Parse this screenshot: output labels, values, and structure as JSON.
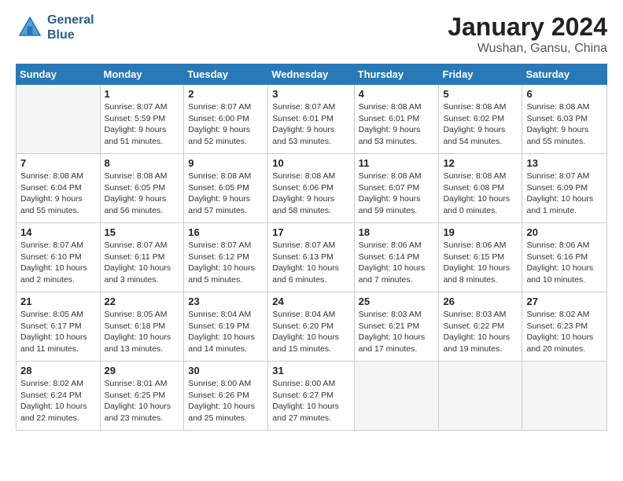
{
  "header": {
    "logo_line1": "General",
    "logo_line2": "Blue",
    "main_title": "January 2024",
    "subtitle": "Wushan, Gansu, China"
  },
  "calendar": {
    "days_of_week": [
      "Sunday",
      "Monday",
      "Tuesday",
      "Wednesday",
      "Thursday",
      "Friday",
      "Saturday"
    ],
    "weeks": [
      [
        {
          "day": "",
          "info": ""
        },
        {
          "day": "1",
          "info": "Sunrise: 8:07 AM\nSunset: 5:59 PM\nDaylight: 9 hours\nand 51 minutes."
        },
        {
          "day": "2",
          "info": "Sunrise: 8:07 AM\nSunset: 6:00 PM\nDaylight: 9 hours\nand 52 minutes."
        },
        {
          "day": "3",
          "info": "Sunrise: 8:07 AM\nSunset: 6:01 PM\nDaylight: 9 hours\nand 53 minutes."
        },
        {
          "day": "4",
          "info": "Sunrise: 8:08 AM\nSunset: 6:01 PM\nDaylight: 9 hours\nand 53 minutes."
        },
        {
          "day": "5",
          "info": "Sunrise: 8:08 AM\nSunset: 6:02 PM\nDaylight: 9 hours\nand 54 minutes."
        },
        {
          "day": "6",
          "info": "Sunrise: 8:08 AM\nSunset: 6:03 PM\nDaylight: 9 hours\nand 55 minutes."
        }
      ],
      [
        {
          "day": "7",
          "info": "Sunrise: 8:08 AM\nSunset: 6:04 PM\nDaylight: 9 hours\nand 55 minutes."
        },
        {
          "day": "8",
          "info": "Sunrise: 8:08 AM\nSunset: 6:05 PM\nDaylight: 9 hours\nand 56 minutes."
        },
        {
          "day": "9",
          "info": "Sunrise: 8:08 AM\nSunset: 6:05 PM\nDaylight: 9 hours\nand 57 minutes."
        },
        {
          "day": "10",
          "info": "Sunrise: 8:08 AM\nSunset: 6:06 PM\nDaylight: 9 hours\nand 58 minutes."
        },
        {
          "day": "11",
          "info": "Sunrise: 8:08 AM\nSunset: 6:07 PM\nDaylight: 9 hours\nand 59 minutes."
        },
        {
          "day": "12",
          "info": "Sunrise: 8:08 AM\nSunset: 6:08 PM\nDaylight: 10 hours\nand 0 minutes."
        },
        {
          "day": "13",
          "info": "Sunrise: 8:07 AM\nSunset: 6:09 PM\nDaylight: 10 hours\nand 1 minute."
        }
      ],
      [
        {
          "day": "14",
          "info": "Sunrise: 8:07 AM\nSunset: 6:10 PM\nDaylight: 10 hours\nand 2 minutes."
        },
        {
          "day": "15",
          "info": "Sunrise: 8:07 AM\nSunset: 6:11 PM\nDaylight: 10 hours\nand 3 minutes."
        },
        {
          "day": "16",
          "info": "Sunrise: 8:07 AM\nSunset: 6:12 PM\nDaylight: 10 hours\nand 5 minutes."
        },
        {
          "day": "17",
          "info": "Sunrise: 8:07 AM\nSunset: 6:13 PM\nDaylight: 10 hours\nand 6 minutes."
        },
        {
          "day": "18",
          "info": "Sunrise: 8:06 AM\nSunset: 6:14 PM\nDaylight: 10 hours\nand 7 minutes."
        },
        {
          "day": "19",
          "info": "Sunrise: 8:06 AM\nSunset: 6:15 PM\nDaylight: 10 hours\nand 8 minutes."
        },
        {
          "day": "20",
          "info": "Sunrise: 8:06 AM\nSunset: 6:16 PM\nDaylight: 10 hours\nand 10 minutes."
        }
      ],
      [
        {
          "day": "21",
          "info": "Sunrise: 8:05 AM\nSunset: 6:17 PM\nDaylight: 10 hours\nand 11 minutes."
        },
        {
          "day": "22",
          "info": "Sunrise: 8:05 AM\nSunset: 6:18 PM\nDaylight: 10 hours\nand 13 minutes."
        },
        {
          "day": "23",
          "info": "Sunrise: 8:04 AM\nSunset: 6:19 PM\nDaylight: 10 hours\nand 14 minutes."
        },
        {
          "day": "24",
          "info": "Sunrise: 8:04 AM\nSunset: 6:20 PM\nDaylight: 10 hours\nand 15 minutes."
        },
        {
          "day": "25",
          "info": "Sunrise: 8:03 AM\nSunset: 6:21 PM\nDaylight: 10 hours\nand 17 minutes."
        },
        {
          "day": "26",
          "info": "Sunrise: 8:03 AM\nSunset: 6:22 PM\nDaylight: 10 hours\nand 19 minutes."
        },
        {
          "day": "27",
          "info": "Sunrise: 8:02 AM\nSunset: 6:23 PM\nDaylight: 10 hours\nand 20 minutes."
        }
      ],
      [
        {
          "day": "28",
          "info": "Sunrise: 8:02 AM\nSunset: 6:24 PM\nDaylight: 10 hours\nand 22 minutes."
        },
        {
          "day": "29",
          "info": "Sunrise: 8:01 AM\nSunset: 6:25 PM\nDaylight: 10 hours\nand 23 minutes."
        },
        {
          "day": "30",
          "info": "Sunrise: 8:00 AM\nSunset: 6:26 PM\nDaylight: 10 hours\nand 25 minutes."
        },
        {
          "day": "31",
          "info": "Sunrise: 8:00 AM\nSunset: 6:27 PM\nDaylight: 10 hours\nand 27 minutes."
        },
        {
          "day": "",
          "info": ""
        },
        {
          "day": "",
          "info": ""
        },
        {
          "day": "",
          "info": ""
        }
      ]
    ]
  }
}
